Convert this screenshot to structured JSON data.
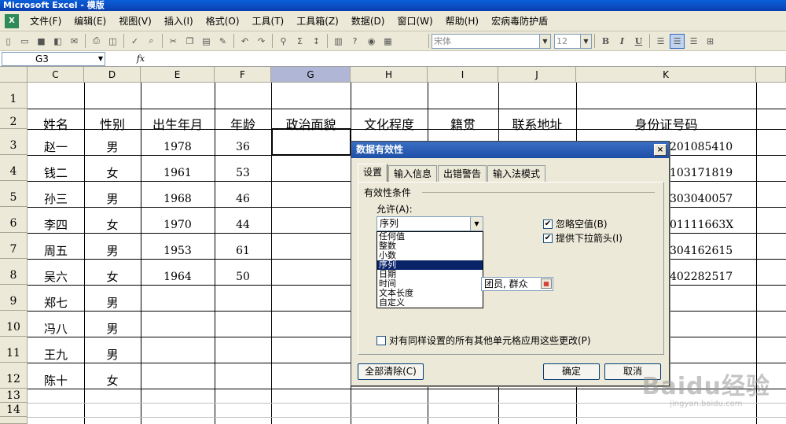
{
  "window": {
    "title": "Microsoft Excel - 模版"
  },
  "menubar": {
    "items": [
      "文件(F)",
      "编辑(E)",
      "视图(V)",
      "插入(I)",
      "格式(O)",
      "工具(T)",
      "工具箱(Z)",
      "数据(D)",
      "窗口(W)",
      "帮助(H)",
      "宏病毒防护盾"
    ]
  },
  "toolbar": {
    "font_name": "宋体",
    "font_size": "12",
    "bold": "B",
    "italic": "I",
    "underline": "U"
  },
  "formula_bar": {
    "name_box": "G3",
    "fx_label": "fx",
    "value": ""
  },
  "columns": [
    "C",
    "D",
    "E",
    "F",
    "G",
    "H",
    "I",
    "J",
    "K"
  ],
  "rows": [
    "1",
    "2",
    "3",
    "4",
    "5",
    "6",
    "7",
    "8",
    "9",
    "10",
    "11",
    "12",
    "13",
    "14"
  ],
  "sheet": {
    "headers": [
      "姓名",
      "性别",
      "出生年月",
      "年龄",
      "政治面貌",
      "文化程度",
      "籍贯",
      "联系地址",
      "身份证号码"
    ],
    "records": [
      {
        "name": "赵一",
        "gender": "男",
        "birth": "1978",
        "age": "36",
        "id": "201085410"
      },
      {
        "name": "钱二",
        "gender": "女",
        "birth": "1961",
        "age": "53",
        "id": "103171819"
      },
      {
        "name": "孙三",
        "gender": "男",
        "birth": "1968",
        "age": "46",
        "id": "303040057"
      },
      {
        "name": "李四",
        "gender": "女",
        "birth": "1970",
        "age": "44",
        "id": "01111663X"
      },
      {
        "name": "周五",
        "gender": "男",
        "birth": "1953",
        "age": "61",
        "id": "304162615"
      },
      {
        "name": "吴六",
        "gender": "女",
        "birth": "1964",
        "age": "50",
        "id": "402282517"
      },
      {
        "name": "郑七",
        "gender": "男",
        "birth": "",
        "age": "",
        "id": ""
      },
      {
        "name": "冯八",
        "gender": "男",
        "birth": "",
        "age": "",
        "id": ""
      },
      {
        "name": "王九",
        "gender": "男",
        "birth": "",
        "age": "",
        "id": ""
      },
      {
        "name": "陈十",
        "gender": "女",
        "birth": "",
        "age": "",
        "id": ""
      }
    ]
  },
  "dialog": {
    "title": "数据有效性",
    "close": "×",
    "tabs": [
      "设置",
      "输入信息",
      "出错警告",
      "输入法模式"
    ],
    "group_label": "有效性条件",
    "allow_label": "允许(A):",
    "allow_value": "序列",
    "dropdown_options": [
      "任何值",
      "整数",
      "小数",
      "序列",
      "日期",
      "时间",
      "文本长度",
      "自定义"
    ],
    "ignore_blank": "忽略空值(B)",
    "dropdown_arrow": "提供下拉箭头(I)",
    "source_value": "团员, 群众",
    "apply_all": "对有同样设置的所有其他单元格应用这些更改(P)",
    "clear_all": "全部清除(C)",
    "ok": "确定",
    "cancel": "取消"
  },
  "watermark": {
    "main": "Baidu经验",
    "sub": "jingyan.baidu.com"
  }
}
